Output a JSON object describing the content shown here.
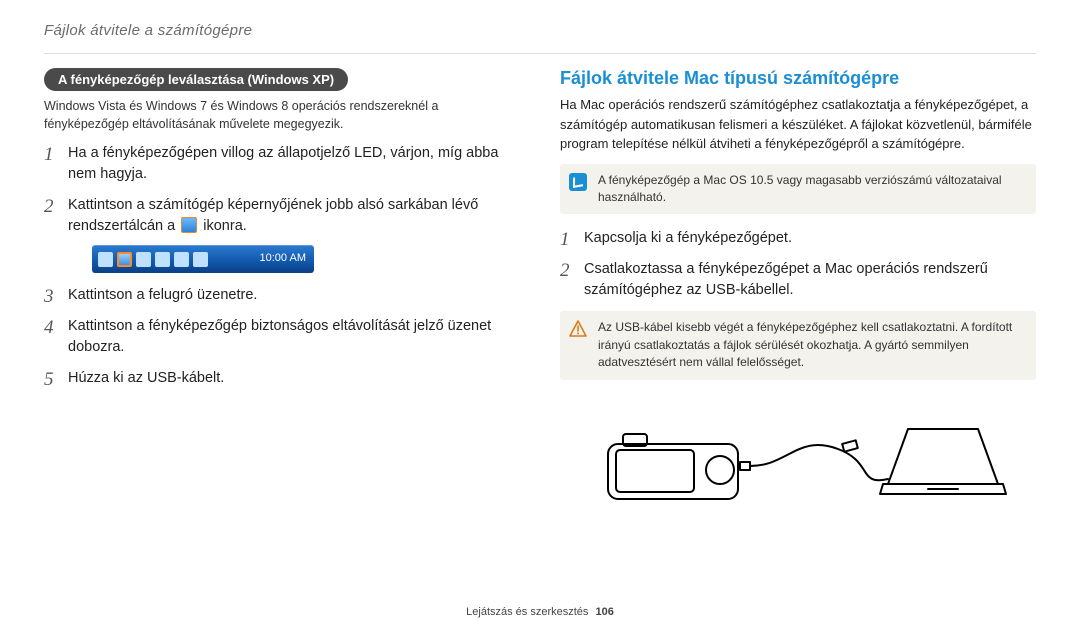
{
  "header": {
    "breadcrumb": "Fájlok átvitele a számítógépre"
  },
  "left": {
    "pill": "A fényképezőgép leválasztása (Windows XP)",
    "intro": "Windows Vista és Windows 7 és Windows 8 operációs rendszereknél a fényképezőgép eltávolításának művelete megegyezik.",
    "steps": {
      "s1": "Ha a fényképezőgépen villog az állapotjelző LED, várjon, míg abba nem hagyja.",
      "s2_pre": "Kattintson a számítógép képernyőjének jobb alsó sarkában lévő rendszertálcán a",
      "s2_post": " ikonra.",
      "s3": "Kattintson a felugró üzenetre.",
      "s4": "Kattintson a fényképezőgép biztonságos eltávolítását jelző üzenet dobozra.",
      "s5": "Húzza ki az USB-kábelt."
    },
    "taskbar_time": "10:00 AM"
  },
  "right": {
    "title": "Fájlok átvitele Mac típusú számítógépre",
    "intro": "Ha Mac operációs rendszerű számítógéphez csatlakoztatja a fényképezőgépet, a számítógép automatikusan felismeri a készüléket. A fájlokat közvetlenül, bármiféle program telepítése nélkül átviheti a fényképezőgépről a számítógépre.",
    "info_note": "A fényképezőgép a Mac OS 10.5 vagy magasabb verziószámú változataival használható.",
    "steps": {
      "s1": "Kapcsolja ki a fényképezőgépet.",
      "s2": "Csatlakoztassa a fényképezőgépet a Mac operációs rendszerű számítógéphez az USB-kábellel."
    },
    "warn_note": "Az USB-kábel kisebb végét a fényképezőgéphez kell csatlakoztatni. A fordított irányú csatlakoztatás a fájlok sérülését okozhatja. A gyártó semmilyen adatvesztésért nem vállal felelősséget."
  },
  "footer": {
    "section": "Lejátszás és szerkesztés",
    "page": "106"
  }
}
